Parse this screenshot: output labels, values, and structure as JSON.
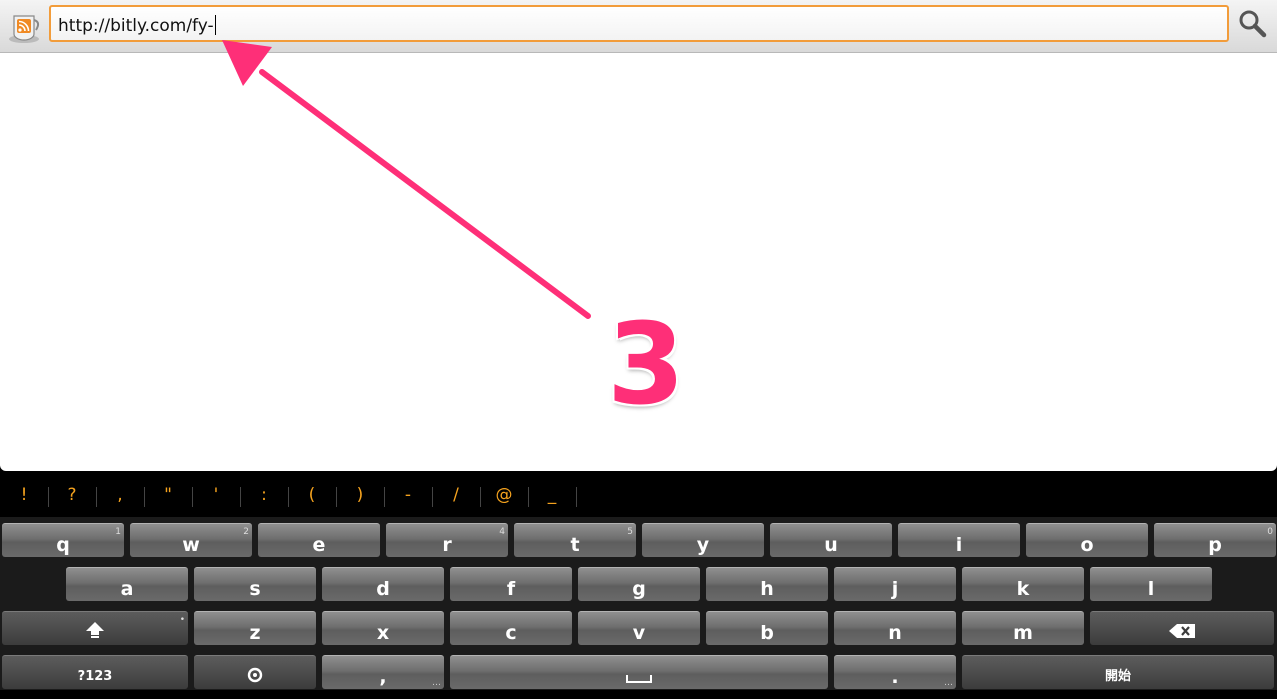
{
  "browser": {
    "url_value": "http://bitly.com/fy-",
    "app_icon": "rss-reader-icon",
    "search_icon": "search-icon",
    "focus_border_color": "#f29c3a"
  },
  "annotation": {
    "step_number": "3",
    "color": "#fe2f78"
  },
  "keyboard": {
    "symbols": [
      "!",
      "?",
      ",",
      "\"",
      "'",
      ":",
      "(",
      ")",
      "-",
      "/",
      "@",
      "_"
    ],
    "row1": [
      {
        "label": "q",
        "hint": "1"
      },
      {
        "label": "w",
        "hint": "2"
      },
      {
        "label": "e",
        "hint": ""
      },
      {
        "label": "r",
        "hint": "4"
      },
      {
        "label": "t",
        "hint": "5"
      },
      {
        "label": "y",
        "hint": ""
      },
      {
        "label": "u",
        "hint": ""
      },
      {
        "label": "i",
        "hint": ""
      },
      {
        "label": "o",
        "hint": ""
      },
      {
        "label": "p",
        "hint": "0"
      }
    ],
    "row2": [
      "a",
      "s",
      "d",
      "f",
      "g",
      "h",
      "j",
      "k",
      "l"
    ],
    "row3": [
      "z",
      "x",
      "c",
      "v",
      "b",
      "n",
      "m"
    ],
    "mode_key": "?123",
    "comma_key": ",",
    "period_key": ".",
    "enter_key": "開始",
    "shift_icon": "shift-icon",
    "backspace_icon": "backspace-icon",
    "settings_icon": "settings-icon",
    "space_icon": "space-icon"
  }
}
